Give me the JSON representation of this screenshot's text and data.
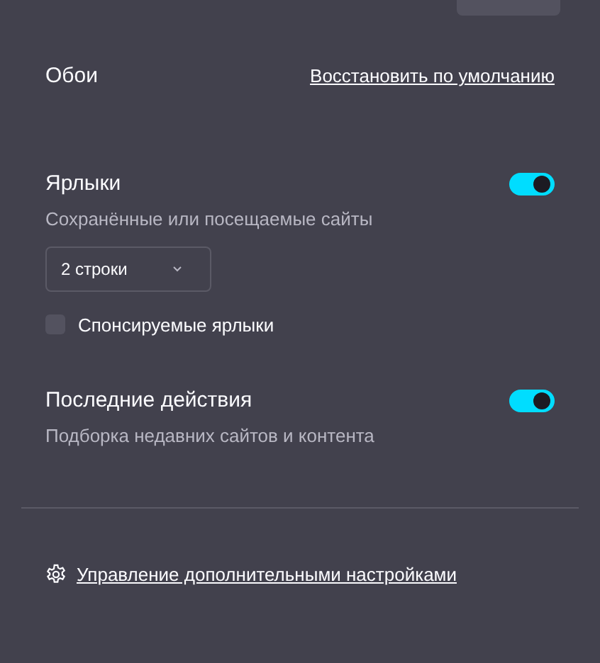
{
  "wallpaper": {
    "title": "Обои",
    "reset_link": "Восстановить по умолчанию"
  },
  "sections": [
    {
      "kind": "shortcuts",
      "title": "Ярлыки",
      "on": true,
      "description": "Сохранённые или посещаемые сайты",
      "dropdown": {
        "value": "2 строки"
      },
      "checkbox": {
        "label": "Спонсируемые ярлыки",
        "checked": false
      }
    },
    {
      "kind": "recent",
      "title": "Последние действия",
      "on": true,
      "description": "Подборка недавних сайтов и контента"
    }
  ],
  "manage_link": "Управление дополнительными настройками"
}
